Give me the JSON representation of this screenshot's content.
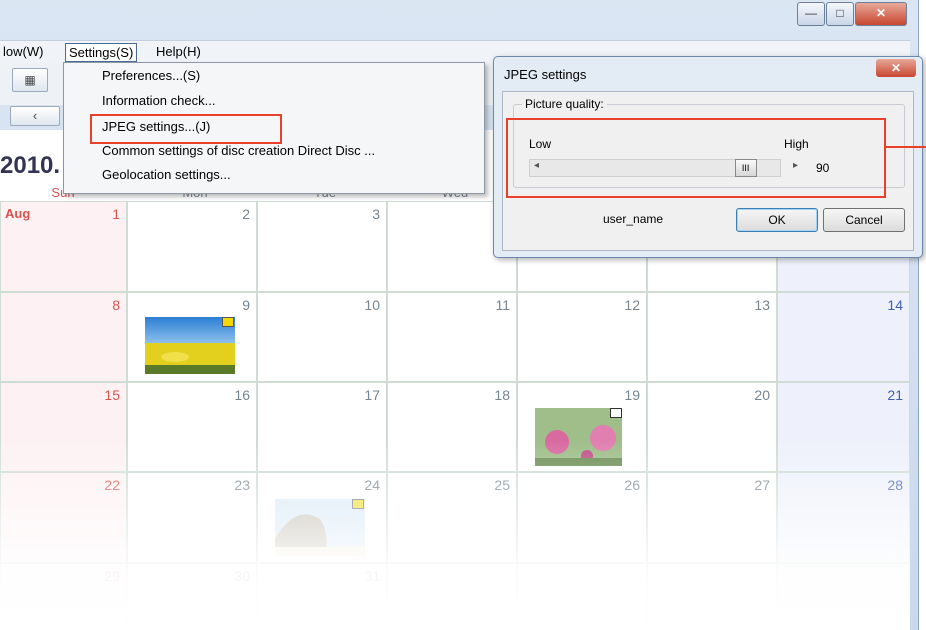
{
  "menubar": {
    "items": [
      "low(W)",
      "Settings(S)",
      "Help(H)"
    ]
  },
  "settings_menu": {
    "items": [
      "Preferences...(S)",
      "Information check...",
      "JPEG settings...(J)",
      "Common settings of disc creation  Direct Disc ...",
      "Geolocation settings..."
    ]
  },
  "calendar": {
    "year_label": "2010.",
    "month_label": "Aug",
    "day_headers": [
      "Sun",
      "Mon",
      "Tue",
      "Wed"
    ],
    "weeks": [
      [
        "1",
        "2",
        "3",
        "",
        "",
        "",
        ""
      ],
      [
        "8",
        "9",
        "10",
        "11",
        "12",
        "13",
        "14"
      ],
      [
        "15",
        "16",
        "17",
        "18",
        "19",
        "20",
        "21"
      ],
      [
        "22",
        "23",
        "24",
        "25",
        "26",
        "27",
        "28"
      ],
      [
        "29",
        "30",
        "31",
        "",
        "",
        "",
        ""
      ]
    ]
  },
  "jpeg_dialog": {
    "title": "JPEG settings",
    "group_label": "Picture quality:",
    "low_label": "Low",
    "high_label": "High",
    "quality_value": "90",
    "quality_level": 0.9,
    "user_label": "user_name",
    "ok_label": "OK",
    "cancel_label": "Cancel"
  },
  "colors": {
    "accent_highlight": "#e8402b",
    "sunday": "#d9534f",
    "saturday": "#3f5fb8"
  }
}
